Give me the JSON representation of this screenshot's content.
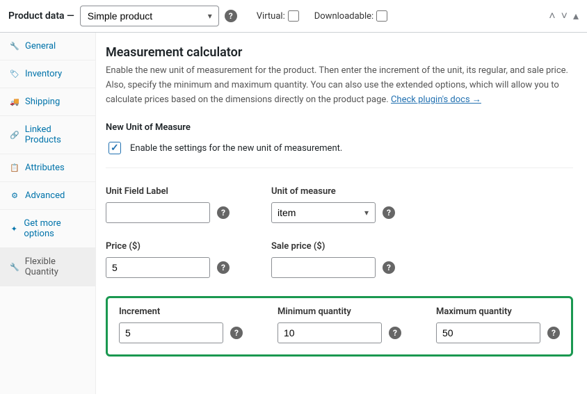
{
  "header": {
    "title": "Product data —",
    "product_type": "Simple product",
    "virtual_label": "Virtual:",
    "virtual_checked": false,
    "downloadable_label": "Downloadable:",
    "downloadable_checked": false
  },
  "sidebar": {
    "items": [
      {
        "label": "General",
        "icon": "wrench-icon"
      },
      {
        "label": "Inventory",
        "icon": "tag-icon"
      },
      {
        "label": "Shipping",
        "icon": "truck-icon"
      },
      {
        "label": "Linked Products",
        "icon": "link-icon"
      },
      {
        "label": "Attributes",
        "icon": "list-icon"
      },
      {
        "label": "Advanced",
        "icon": "gear-icon"
      },
      {
        "label": "Get more options",
        "icon": "sparkle-icon"
      },
      {
        "label": "Flexible Quantity",
        "icon": "wrench-icon"
      }
    ],
    "active": 7
  },
  "content": {
    "heading": "Measurement calculator",
    "description": "Enable the new unit of measurement for the product. Then enter the increment of the unit, its regular, and sale price. Also, specify the minimum and maximum quantity. You can also use the extended options, which will allow you to calculate prices based on the dimensions directly on the product page. ",
    "docs_link": "Check plugin's docs →",
    "section_title": "New Unit of Measure",
    "enable_label": "Enable the settings for the new unit of measurement.",
    "enable_checked": true,
    "fields": {
      "unit_field_label": {
        "label": "Unit Field Label",
        "value": ""
      },
      "unit_of_measure": {
        "label": "Unit of measure",
        "value": "item"
      },
      "price": {
        "label": "Price ($)",
        "value": "5"
      },
      "sale_price": {
        "label": "Sale price ($)",
        "value": ""
      },
      "increment": {
        "label": "Increment",
        "value": "5"
      },
      "min_qty": {
        "label": "Minimum quantity",
        "value": "10"
      },
      "max_qty": {
        "label": "Maximum quantity",
        "value": "50"
      }
    }
  }
}
